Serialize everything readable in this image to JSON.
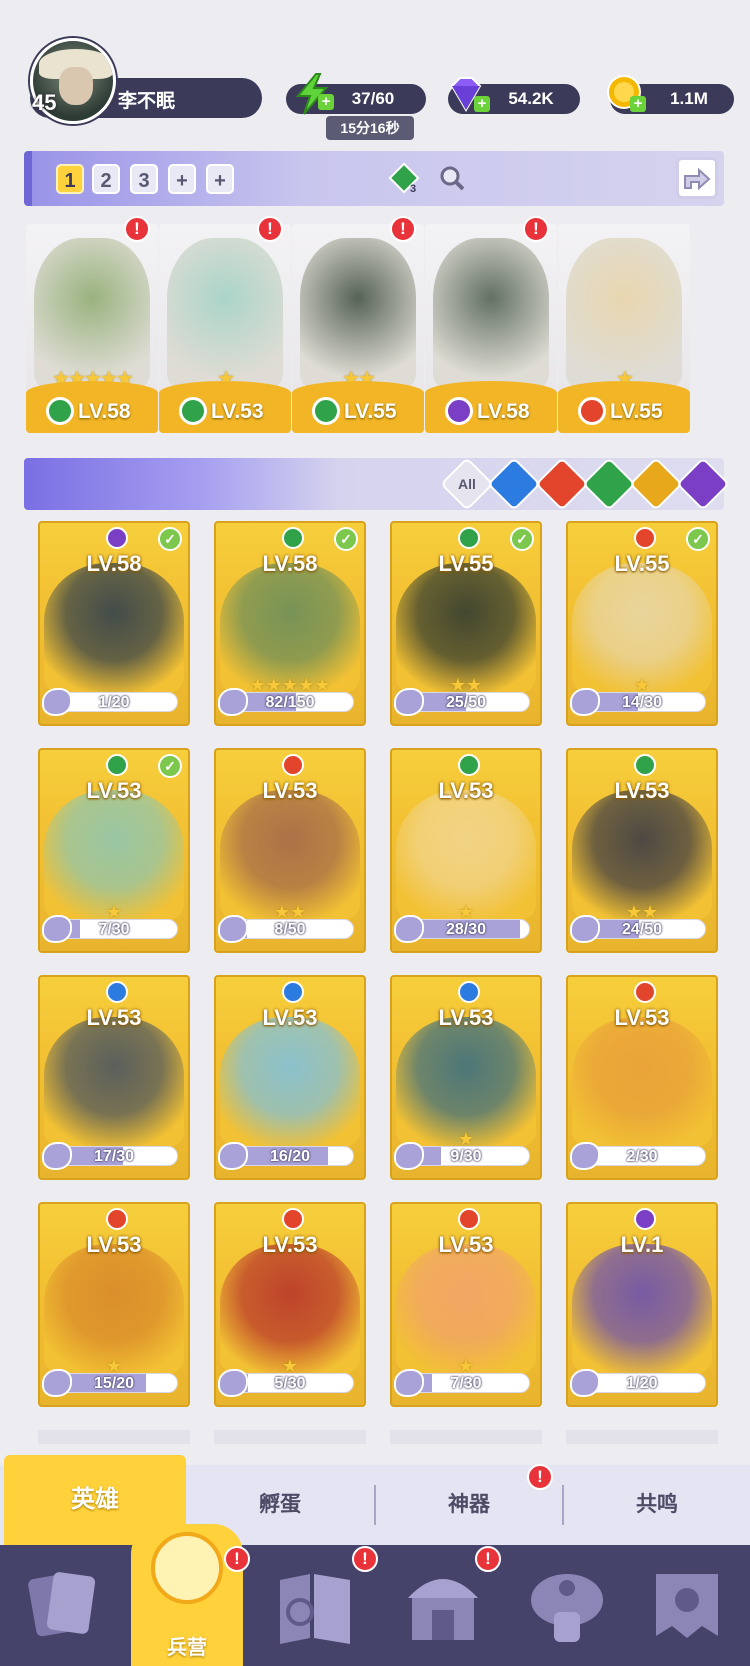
{
  "player": {
    "level": "45",
    "name": "李不眠"
  },
  "resources": {
    "energy": {
      "value": "37/60",
      "timer": "15分16秒",
      "icon": "lightning-icon",
      "color": "#5ed43a"
    },
    "gems": {
      "value": "54.2K",
      "icon": "gem-icon",
      "color": "#8b5cf6"
    },
    "gold": {
      "value": "1.1M",
      "icon": "coin-icon",
      "color": "#f5b800"
    }
  },
  "team_bar": {
    "slots": [
      "1",
      "2",
      "3",
      "+",
      "+"
    ],
    "active_slot": "1",
    "badge_count": "3"
  },
  "team": [
    {
      "level": "LV.58",
      "stars": "★★★★★",
      "element": "nature",
      "alert": "!"
    },
    {
      "level": "LV.53",
      "stars": "★",
      "element": "nature",
      "alert": "!"
    },
    {
      "level": "LV.55",
      "stars": "★★",
      "element": "nature",
      "alert": "!"
    },
    {
      "level": "LV.58",
      "stars": "",
      "element": "dark",
      "alert": "!"
    },
    {
      "level": "LV.55",
      "stars": "★",
      "element": "fire",
      "alert": ""
    }
  ],
  "filters": [
    {
      "label": "All",
      "element": "all"
    },
    {
      "label": "",
      "element": "water"
    },
    {
      "label": "",
      "element": "fire"
    },
    {
      "label": "",
      "element": "nature"
    },
    {
      "label": "",
      "element": "light"
    },
    {
      "label": "",
      "element": "dark"
    }
  ],
  "element_colors": {
    "nature": "#2fa24a",
    "dark": "#7a3fc4",
    "fire": "#e2452b",
    "water": "#2c7be0",
    "light": "#e8a81c",
    "all": "#7b7a8c"
  },
  "heroes": [
    {
      "level": "LV.58",
      "element": "dark",
      "checked": true,
      "stars": "",
      "progress": "1/20",
      "fill": 0.05,
      "art": "#2f3f4c"
    },
    {
      "level": "LV.58",
      "element": "nature",
      "checked": true,
      "stars": "★★★★★",
      "progress": "82/150",
      "fill": 0.55,
      "art": "#6a8e5a"
    },
    {
      "level": "LV.55",
      "element": "nature",
      "checked": true,
      "stars": "★★",
      "progress": "25/50",
      "fill": 0.5,
      "art": "#2f3a30"
    },
    {
      "level": "LV.55",
      "element": "fire",
      "checked": true,
      "stars": "★",
      "progress": "14/30",
      "fill": 0.47,
      "art": "#e8d7a8"
    },
    {
      "level": "LV.53",
      "element": "nature",
      "checked": true,
      "stars": "★",
      "progress": "7/30",
      "fill": 0.23,
      "art": "#8fc7b0"
    },
    {
      "level": "LV.53",
      "element": "fire",
      "checked": false,
      "stars": "★★",
      "progress": "8/50",
      "fill": 0.16,
      "art": "#a36a4a"
    },
    {
      "level": "LV.53",
      "element": "nature",
      "checked": false,
      "stars": "★",
      "progress": "28/30",
      "fill": 0.93,
      "art": "#f2d68f"
    },
    {
      "level": "LV.53",
      "element": "nature",
      "checked": false,
      "stars": "★★",
      "progress": "24/50",
      "fill": 0.48,
      "art": "#3b3b45"
    },
    {
      "level": "LV.53",
      "element": "water",
      "checked": false,
      "stars": "",
      "progress": "17/30",
      "fill": 0.57,
      "art": "#4a5560"
    },
    {
      "level": "LV.53",
      "element": "water",
      "checked": false,
      "stars": "",
      "progress": "16/20",
      "fill": 0.8,
      "art": "#7fc1dd"
    },
    {
      "level": "LV.53",
      "element": "water",
      "checked": false,
      "stars": "★",
      "progress": "9/30",
      "fill": 0.3,
      "art": "#3a6e80"
    },
    {
      "level": "LV.53",
      "element": "fire",
      "checked": false,
      "stars": "",
      "progress": "2/30",
      "fill": 0.07,
      "art": "#e9a13a"
    },
    {
      "level": "LV.53",
      "element": "fire",
      "checked": false,
      "stars": "★",
      "progress": "15/20",
      "fill": 0.75,
      "art": "#d98a2a"
    },
    {
      "level": "LV.53",
      "element": "fire",
      "checked": false,
      "stars": "★",
      "progress": "5/30",
      "fill": 0.17,
      "art": "#b8352a"
    },
    {
      "level": "LV.53",
      "element": "fire",
      "checked": false,
      "stars": "★",
      "progress": "7/30",
      "fill": 0.23,
      "art": "#f2a46a"
    },
    {
      "level": "LV.1",
      "element": "dark",
      "checked": false,
      "stars": "",
      "progress": "1/20",
      "fill": 0.05,
      "art": "#6a4fb0"
    }
  ],
  "subtabs": {
    "heroes": "英雄",
    "hatch": "孵蛋",
    "artifacts": "神器",
    "resonance": "共鸣",
    "artifacts_alert": "!"
  },
  "nav": {
    "barracks": "兵营",
    "alert": "!"
  }
}
